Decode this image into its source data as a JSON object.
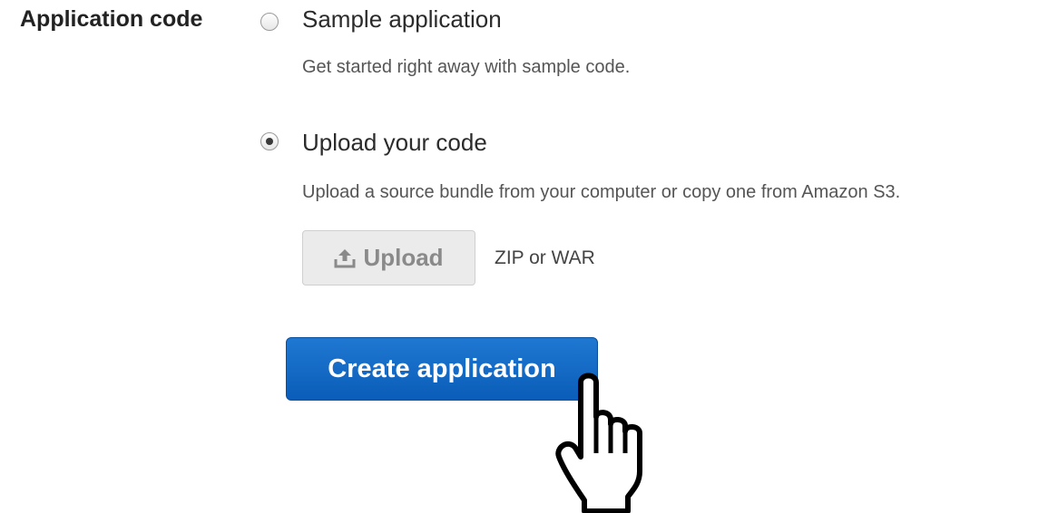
{
  "form": {
    "field_label": "Application code",
    "options": [
      {
        "label": "Sample application",
        "description": "Get started right away with sample code.",
        "selected": false
      },
      {
        "label": "Upload your code",
        "description": "Upload a source bundle from your computer or copy one from Amazon S3.",
        "selected": true
      }
    ],
    "upload_button_label": "Upload",
    "upload_icon": "upload-icon",
    "upload_hint": "ZIP or WAR",
    "submit_button_label": "Create application"
  },
  "cursor": {
    "icon": "hand-pointer-icon"
  },
  "colors": {
    "primary_button": "#0a5db8",
    "upload_button_bg": "#ebebeb"
  }
}
